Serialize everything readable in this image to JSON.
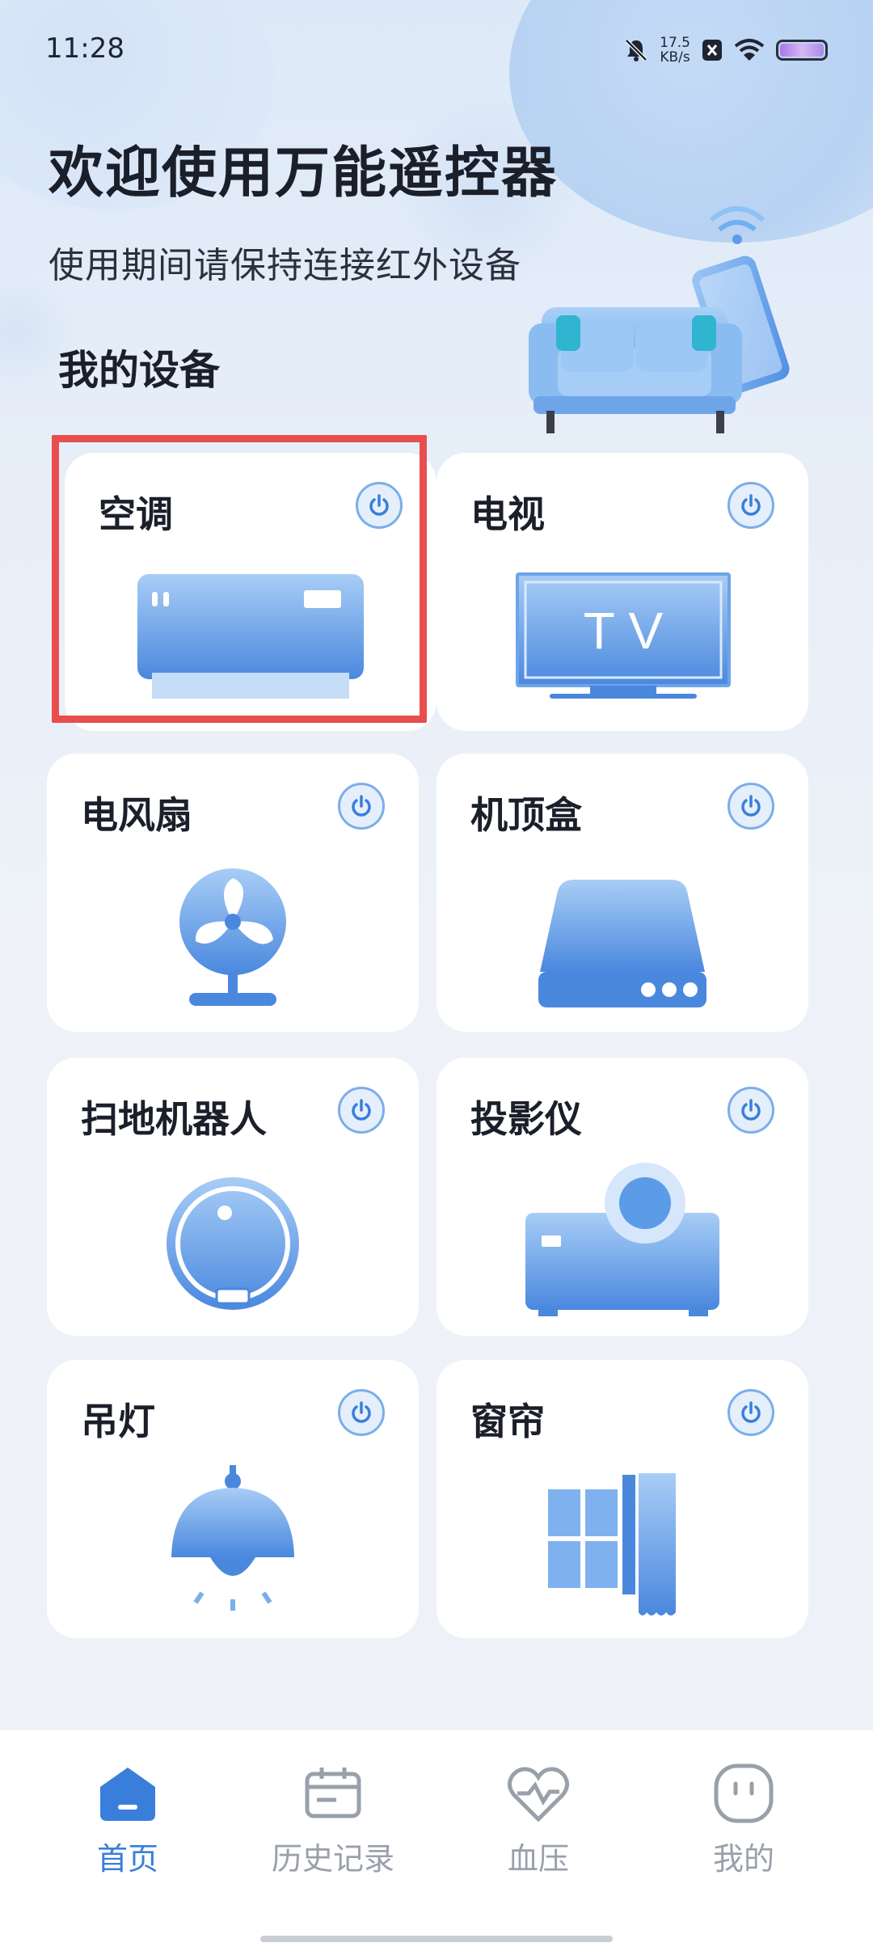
{
  "status_bar": {
    "time": "11:28",
    "speed_value": "17.5",
    "speed_unit": "KB/s"
  },
  "header": {
    "title": "欢迎使用万能遥控器",
    "subtitle": "使用期间请保持连接红外设备"
  },
  "section_title": "我的设备",
  "devices": [
    {
      "label": "空调",
      "icon": "air-conditioner-icon",
      "highlighted": true
    },
    {
      "label": "电视",
      "icon": "tv-icon",
      "screen_text": "T V"
    },
    {
      "label": "电风扇",
      "icon": "fan-icon"
    },
    {
      "label": "机顶盒",
      "icon": "set-top-box-icon"
    },
    {
      "label": "扫地机器人",
      "icon": "robot-vacuum-icon"
    },
    {
      "label": "投影仪",
      "icon": "projector-icon"
    },
    {
      "label": "吊灯",
      "icon": "pendant-lamp-icon"
    },
    {
      "label": "窗帘",
      "icon": "curtain-icon"
    }
  ],
  "tabs": [
    {
      "label": "首页",
      "icon": "home-icon",
      "active": true
    },
    {
      "label": "历史记录",
      "icon": "history-icon"
    },
    {
      "label": "血压",
      "icon": "heart-pulse-icon"
    },
    {
      "label": "我的",
      "icon": "profile-icon"
    }
  ],
  "colors": {
    "accent": "#3a7edb",
    "highlight": "#e84e4e",
    "icon_blue": "#5b9be8"
  }
}
